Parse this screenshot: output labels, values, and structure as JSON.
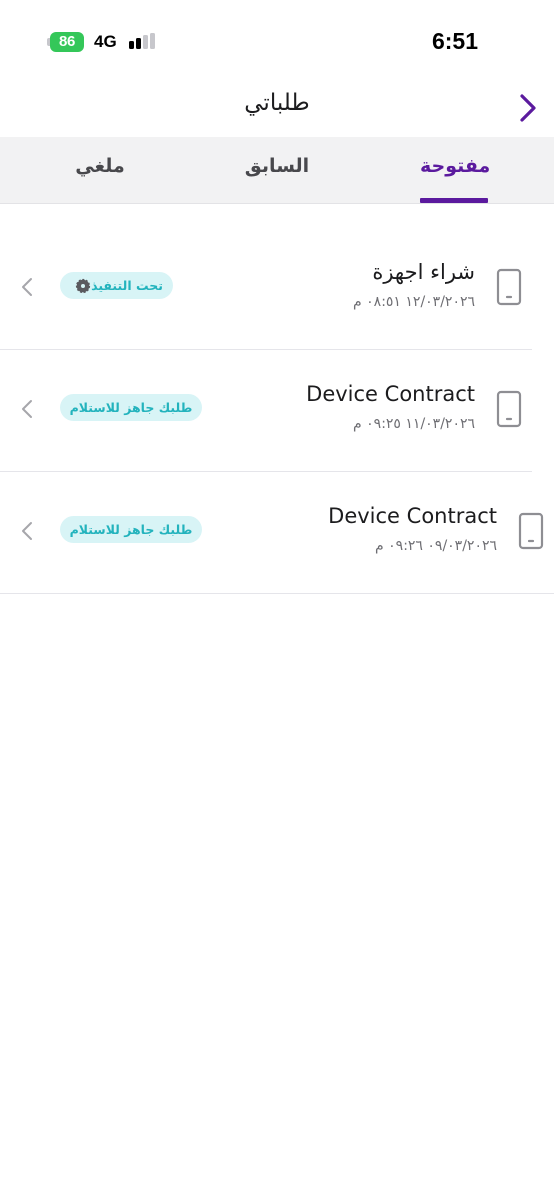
{
  "status_bar": {
    "battery_level": "86",
    "network": "4G",
    "time": "6:51",
    "battery_color": "#34c759"
  },
  "header": {
    "title": "طلباتي",
    "back_icon": "chevron-right-icon",
    "accent_color": "#5b1a9e"
  },
  "tabs": [
    {
      "label": "مفتوحة",
      "active": true
    },
    {
      "label": "السابق",
      "active": false
    },
    {
      "label": "ملغي",
      "active": false
    }
  ],
  "orders": [
    {
      "title": "شراء اجهزة",
      "date": "١٢/٠٣/٢٠٢٦ ٠٨:٥١ م",
      "status": "تحت التنفيذ",
      "status_icon": "gear-icon",
      "icon": "mobile-device-icon"
    },
    {
      "title": "Device Contract",
      "date": "١١/٠٣/٢٠٢٦ ٠٩:٢٥ م",
      "status": "طلبك جاهز للاستلام",
      "icon": "mobile-device-icon"
    },
    {
      "title": "Device Contract",
      "date": "٠٩/٠٣/٢٠٢٦ ٠٩:٢٦ م",
      "status": "طلبك جاهز للاستلام",
      "icon": "mobile-device-icon"
    }
  ],
  "status_pill_color": "#d8f4f6",
  "status_text_color": "#23b3bd"
}
